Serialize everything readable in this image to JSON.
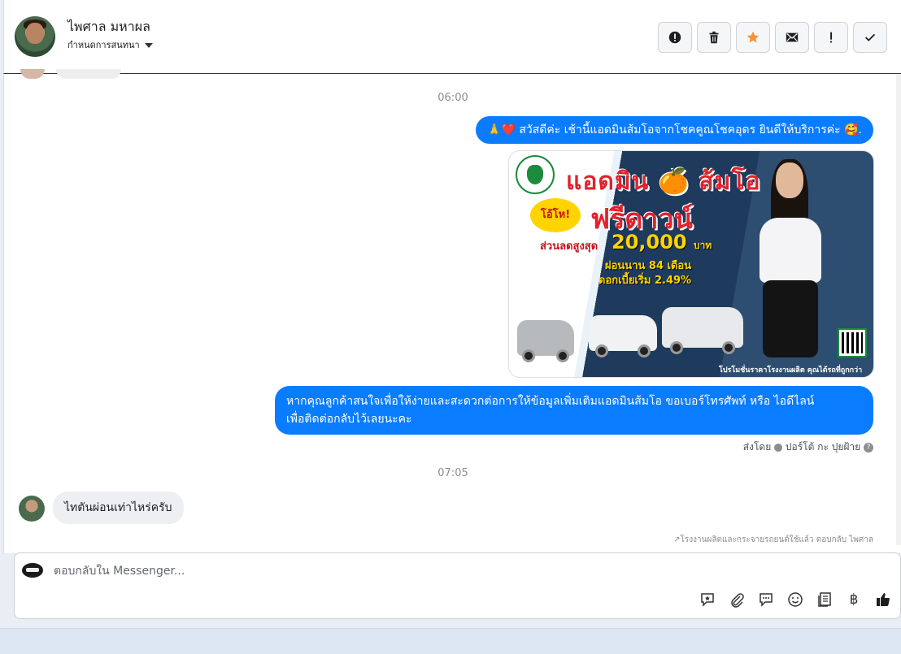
{
  "header": {
    "contact_name": "ไพศาล มหาผล",
    "assign_label": "กำหนดการสนทนา",
    "toolbar_icons": [
      "spam-icon",
      "trash-icon",
      "star-icon",
      "mail-icon",
      "follow-up-icon",
      "check-icon"
    ],
    "star_color": "#f7923a"
  },
  "conversation": {
    "time_1": "06:00",
    "greeting_text": "🙏❤️ สวัสดีค่ะ เช้านี้แอดมินส้มโอจากโชคคูณโชคอุดร ยินดีให้บริการค่ะ 🥰.",
    "promo": {
      "title": "แอดมิน 🍊 ส้มโอ",
      "burst": "โอ้โห!",
      "headline": "ฟรีดาวน์",
      "discount_label": "ส่วนลดสูงสุด",
      "discount_amount": "20,000",
      "discount_unit": "บาท",
      "installment": "ผ่อนนาน 84 เดือน",
      "interest": "ดอกเบี้ยเริ่ม 2.49%",
      "footer": "โปรโมชั่นราคาโรงงานผลิต คุณได้รถที่ถูกกว่า"
    },
    "followup_text_line1": "หากคุณลูกค้าสนใจเพื่อให้ง่ายและสะดวกต่อการให้ข้อมูลเพิ่มเติมแอดมินส้มโอ ขอเบอร์โทรศัพท์ หรือ ไอดีไลน์",
    "followup_text_line2": "เพื่อติดต่อกลับไว้เลยนะคะ",
    "sent_by_prefix": "ส่งโดย",
    "sent_by_name": "ปอร์โต้ กะ ปุยฝ้าย",
    "time_2": "07:05",
    "incoming_text": "ไทตันผ่อนเท่าไหร่ครับ",
    "auto_reply_note": "↗โรงงานผลิตและกระจายรถยนต์ใช้แล้ว ตอบกลับ ไพศาล"
  },
  "composer": {
    "placeholder": "ตอบกลับใน Messenger...",
    "tools": [
      "saved-reply-icon",
      "attach-icon",
      "chat-bubbles-icon",
      "emoji-icon",
      "catalog-icon",
      "baht-icon",
      "like-icon"
    ],
    "baht_symbol": "฿",
    "accent": "#0a7cff"
  }
}
